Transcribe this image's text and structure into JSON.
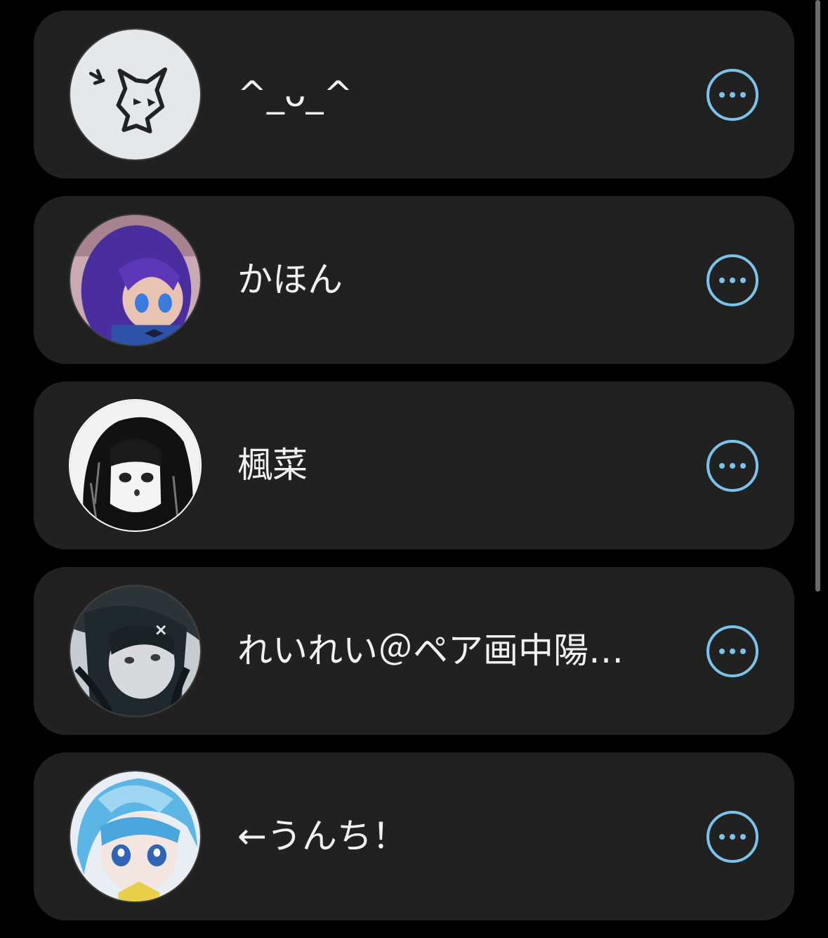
{
  "accent_color": "#7cc3ec",
  "card_color": "#212121",
  "users": [
    {
      "name": "^_ᴗ_^",
      "avatar": "cat-doodle-avatar",
      "more_icon": "more-options-icon"
    },
    {
      "name": "かほん",
      "avatar": "purple-hair-girl-avatar",
      "more_icon": "more-options-icon"
    },
    {
      "name": "楓菜",
      "avatar": "monochrome-girl-avatar",
      "more_icon": "more-options-icon"
    },
    {
      "name": "れいれい＠ペア画中陽…",
      "avatar": "dark-hair-girl-avatar",
      "more_icon": "more-options-icon"
    },
    {
      "name": "←うんち！",
      "avatar": "blue-hair-boy-avatar",
      "more_icon": "more-options-icon"
    }
  ]
}
